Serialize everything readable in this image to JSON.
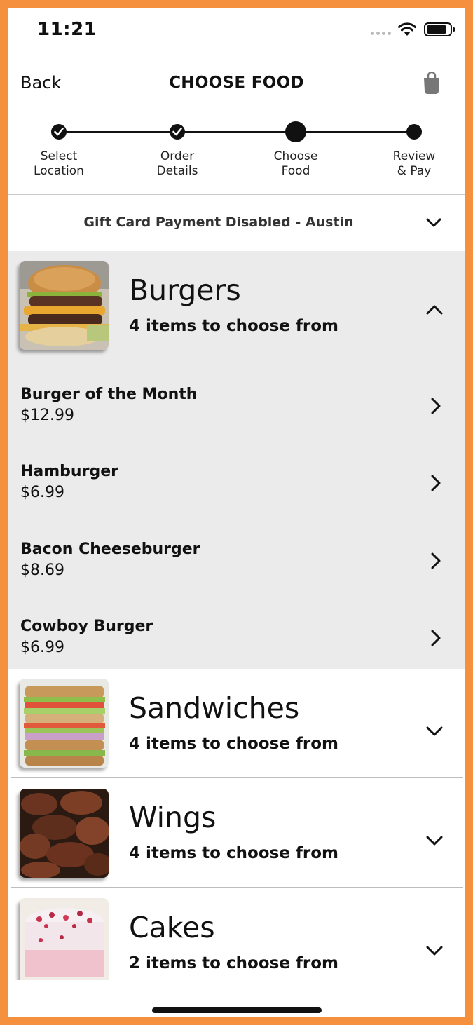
{
  "status_bar": {
    "time": "11:21"
  },
  "nav": {
    "back_label": "Back",
    "title": "CHOOSE FOOD"
  },
  "stepper": {
    "steps": [
      {
        "label": "Select\nLocation",
        "state": "done"
      },
      {
        "label": "Order\nDetails",
        "state": "done"
      },
      {
        "label": "Choose\nFood",
        "state": "current"
      },
      {
        "label": "Review\n& Pay",
        "state": "pending"
      }
    ]
  },
  "location": {
    "text": "Gift Card Payment Disabled - Austin"
  },
  "categories": [
    {
      "name": "Burgers",
      "count_text": "4 items to choose from",
      "expanded": true,
      "items": [
        {
          "name": "Burger of the Month",
          "price": "$12.99"
        },
        {
          "name": "Hamburger",
          "price": "$6.99"
        },
        {
          "name": "Bacon Cheeseburger",
          "price": "$8.69"
        },
        {
          "name": "Cowboy Burger",
          "price": "$6.99"
        }
      ]
    },
    {
      "name": "Sandwiches",
      "count_text": "4 items to choose from",
      "expanded": false
    },
    {
      "name": "Wings",
      "count_text": "4 items to choose from",
      "expanded": false
    },
    {
      "name": "Cakes",
      "count_text": "2 items to choose from",
      "expanded": false
    }
  ],
  "colors": {
    "frame": "#F5913E",
    "expanded_bg": "#EBEBEB",
    "text": "#111111"
  }
}
